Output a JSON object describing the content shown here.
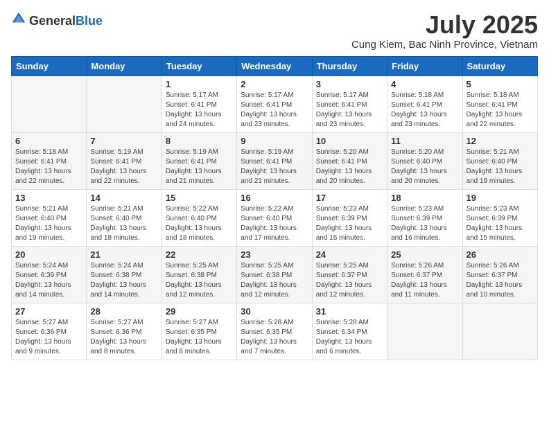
{
  "header": {
    "logo_general": "General",
    "logo_blue": "Blue",
    "title": "July 2025",
    "subtitle": "Cung Kiem, Bac Ninh Province, Vietnam"
  },
  "days_of_week": [
    "Sunday",
    "Monday",
    "Tuesday",
    "Wednesday",
    "Thursday",
    "Friday",
    "Saturday"
  ],
  "weeks": [
    [
      {
        "day": "",
        "sunrise": "",
        "sunset": "",
        "daylight": ""
      },
      {
        "day": "",
        "sunrise": "",
        "sunset": "",
        "daylight": ""
      },
      {
        "day": "1",
        "sunrise": "Sunrise: 5:17 AM",
        "sunset": "Sunset: 6:41 PM",
        "daylight": "Daylight: 13 hours and 24 minutes."
      },
      {
        "day": "2",
        "sunrise": "Sunrise: 5:17 AM",
        "sunset": "Sunset: 6:41 PM",
        "daylight": "Daylight: 13 hours and 23 minutes."
      },
      {
        "day": "3",
        "sunrise": "Sunrise: 5:17 AM",
        "sunset": "Sunset: 6:41 PM",
        "daylight": "Daylight: 13 hours and 23 minutes."
      },
      {
        "day": "4",
        "sunrise": "Sunrise: 5:18 AM",
        "sunset": "Sunset: 6:41 PM",
        "daylight": "Daylight: 13 hours and 23 minutes."
      },
      {
        "day": "5",
        "sunrise": "Sunrise: 5:18 AM",
        "sunset": "Sunset: 6:41 PM",
        "daylight": "Daylight: 13 hours and 22 minutes."
      }
    ],
    [
      {
        "day": "6",
        "sunrise": "Sunrise: 5:18 AM",
        "sunset": "Sunset: 6:41 PM",
        "daylight": "Daylight: 13 hours and 22 minutes."
      },
      {
        "day": "7",
        "sunrise": "Sunrise: 5:19 AM",
        "sunset": "Sunset: 6:41 PM",
        "daylight": "Daylight: 13 hours and 22 minutes."
      },
      {
        "day": "8",
        "sunrise": "Sunrise: 5:19 AM",
        "sunset": "Sunset: 6:41 PM",
        "daylight": "Daylight: 13 hours and 21 minutes."
      },
      {
        "day": "9",
        "sunrise": "Sunrise: 5:19 AM",
        "sunset": "Sunset: 6:41 PM",
        "daylight": "Daylight: 13 hours and 21 minutes."
      },
      {
        "day": "10",
        "sunrise": "Sunrise: 5:20 AM",
        "sunset": "Sunset: 6:41 PM",
        "daylight": "Daylight: 13 hours and 20 minutes."
      },
      {
        "day": "11",
        "sunrise": "Sunrise: 5:20 AM",
        "sunset": "Sunset: 6:40 PM",
        "daylight": "Daylight: 13 hours and 20 minutes."
      },
      {
        "day": "12",
        "sunrise": "Sunrise: 5:21 AM",
        "sunset": "Sunset: 6:40 PM",
        "daylight": "Daylight: 13 hours and 19 minutes."
      }
    ],
    [
      {
        "day": "13",
        "sunrise": "Sunrise: 5:21 AM",
        "sunset": "Sunset: 6:40 PM",
        "daylight": "Daylight: 13 hours and 19 minutes."
      },
      {
        "day": "14",
        "sunrise": "Sunrise: 5:21 AM",
        "sunset": "Sunset: 6:40 PM",
        "daylight": "Daylight: 13 hours and 18 minutes."
      },
      {
        "day": "15",
        "sunrise": "Sunrise: 5:22 AM",
        "sunset": "Sunset: 6:40 PM",
        "daylight": "Daylight: 13 hours and 18 minutes."
      },
      {
        "day": "16",
        "sunrise": "Sunrise: 5:22 AM",
        "sunset": "Sunset: 6:40 PM",
        "daylight": "Daylight: 13 hours and 17 minutes."
      },
      {
        "day": "17",
        "sunrise": "Sunrise: 5:23 AM",
        "sunset": "Sunset: 6:39 PM",
        "daylight": "Daylight: 13 hours and 16 minutes."
      },
      {
        "day": "18",
        "sunrise": "Sunrise: 5:23 AM",
        "sunset": "Sunset: 6:39 PM",
        "daylight": "Daylight: 13 hours and 16 minutes."
      },
      {
        "day": "19",
        "sunrise": "Sunrise: 5:23 AM",
        "sunset": "Sunset: 6:39 PM",
        "daylight": "Daylight: 13 hours and 15 minutes."
      }
    ],
    [
      {
        "day": "20",
        "sunrise": "Sunrise: 5:24 AM",
        "sunset": "Sunset: 6:39 PM",
        "daylight": "Daylight: 13 hours and 14 minutes."
      },
      {
        "day": "21",
        "sunrise": "Sunrise: 5:24 AM",
        "sunset": "Sunset: 6:38 PM",
        "daylight": "Daylight: 13 hours and 14 minutes."
      },
      {
        "day": "22",
        "sunrise": "Sunrise: 5:25 AM",
        "sunset": "Sunset: 6:38 PM",
        "daylight": "Daylight: 13 hours and 12 minutes."
      },
      {
        "day": "23",
        "sunrise": "Sunrise: 5:25 AM",
        "sunset": "Sunset: 6:38 PM",
        "daylight": "Daylight: 13 hours and 12 minutes."
      },
      {
        "day": "24",
        "sunrise": "Sunrise: 5:25 AM",
        "sunset": "Sunset: 6:37 PM",
        "daylight": "Daylight: 13 hours and 12 minutes."
      },
      {
        "day": "25",
        "sunrise": "Sunrise: 5:26 AM",
        "sunset": "Sunset: 6:37 PM",
        "daylight": "Daylight: 13 hours and 11 minutes."
      },
      {
        "day": "26",
        "sunrise": "Sunrise: 5:26 AM",
        "sunset": "Sunset: 6:37 PM",
        "daylight": "Daylight: 13 hours and 10 minutes."
      }
    ],
    [
      {
        "day": "27",
        "sunrise": "Sunrise: 5:27 AM",
        "sunset": "Sunset: 6:36 PM",
        "daylight": "Daylight: 13 hours and 9 minutes."
      },
      {
        "day": "28",
        "sunrise": "Sunrise: 5:27 AM",
        "sunset": "Sunset: 6:36 PM",
        "daylight": "Daylight: 13 hours and 8 minutes."
      },
      {
        "day": "29",
        "sunrise": "Sunrise: 5:27 AM",
        "sunset": "Sunset: 6:35 PM",
        "daylight": "Daylight: 13 hours and 8 minutes."
      },
      {
        "day": "30",
        "sunrise": "Sunrise: 5:28 AM",
        "sunset": "Sunset: 6:35 PM",
        "daylight": "Daylight: 13 hours and 7 minutes."
      },
      {
        "day": "31",
        "sunrise": "Sunrise: 5:28 AM",
        "sunset": "Sunset: 6:34 PM",
        "daylight": "Daylight: 13 hours and 6 minutes."
      },
      {
        "day": "",
        "sunrise": "",
        "sunset": "",
        "daylight": ""
      },
      {
        "day": "",
        "sunrise": "",
        "sunset": "",
        "daylight": ""
      }
    ]
  ]
}
